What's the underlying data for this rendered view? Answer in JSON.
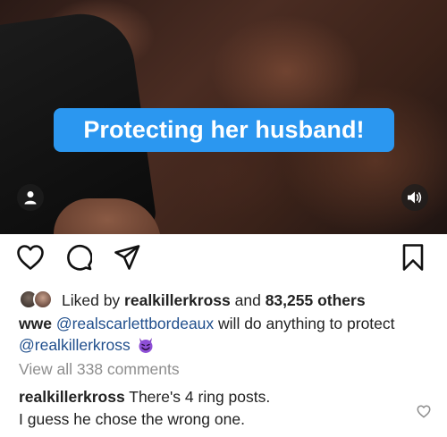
{
  "video": {
    "caption_text": "Protecting her husband!",
    "user_icon": "user-icon",
    "sound_icon": "speaker-icon"
  },
  "actions": {
    "like_icon": "heart-icon",
    "comment_icon": "comment-icon",
    "share_icon": "paper-plane-icon",
    "save_icon": "bookmark-icon"
  },
  "likes": {
    "prefix": "Liked by ",
    "user": "realkillerkross",
    "middle": " and ",
    "count": "83,255 others"
  },
  "caption": {
    "author": "wwe",
    "mention1": "@realscarlettbordeaux",
    "text1": " will do anything to protect ",
    "mention2": "@realkillerkross",
    "emoji": "smiling-devil-emoji"
  },
  "view_all_comments": "View all 338 comments",
  "comment": {
    "author": "realkillerkross",
    "text": " There's 4 ring posts.",
    "text2": "I guess he chose the wrong one.",
    "like_icon": "heart-icon"
  },
  "colors": {
    "caption_bg": "#2b97f0",
    "mention": "#1f4e8c",
    "muted": "#8e8e8e"
  }
}
